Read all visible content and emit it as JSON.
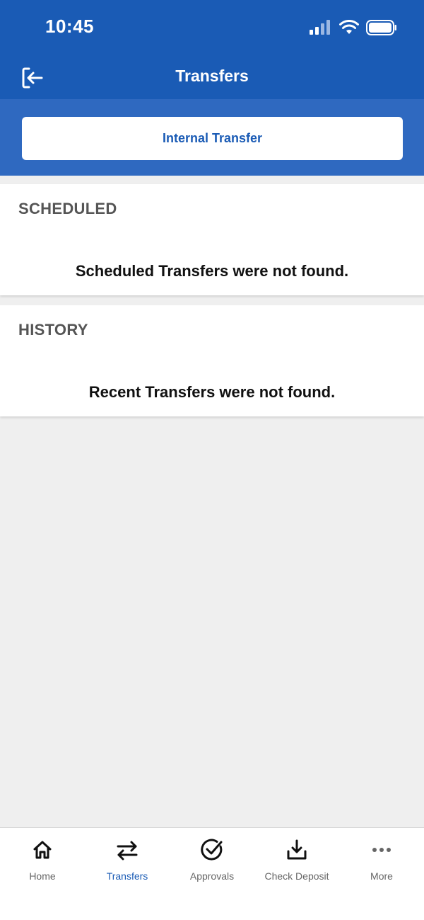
{
  "status": {
    "time": "10:45"
  },
  "nav": {
    "title": "Transfers"
  },
  "actions": {
    "internal_transfer_label": "Internal Transfer"
  },
  "sections": {
    "scheduled": {
      "title": "SCHEDULED",
      "empty_text": "Scheduled Transfers were not found."
    },
    "history": {
      "title": "HISTORY",
      "empty_text": "Recent Transfers were not found."
    }
  },
  "tabs": [
    {
      "label": "Home",
      "icon": "home-icon"
    },
    {
      "label": "Transfers",
      "icon": "transfer-arrows-icon",
      "active": true
    },
    {
      "label": "Approvals",
      "icon": "check-circle-icon"
    },
    {
      "label": "Check Deposit",
      "icon": "download-tray-icon"
    },
    {
      "label": "More",
      "icon": "ellipsis-icon"
    }
  ],
  "colors": {
    "primary": "#1a5bb5",
    "action_bg": "#2f69c0",
    "background": "#efefef"
  }
}
